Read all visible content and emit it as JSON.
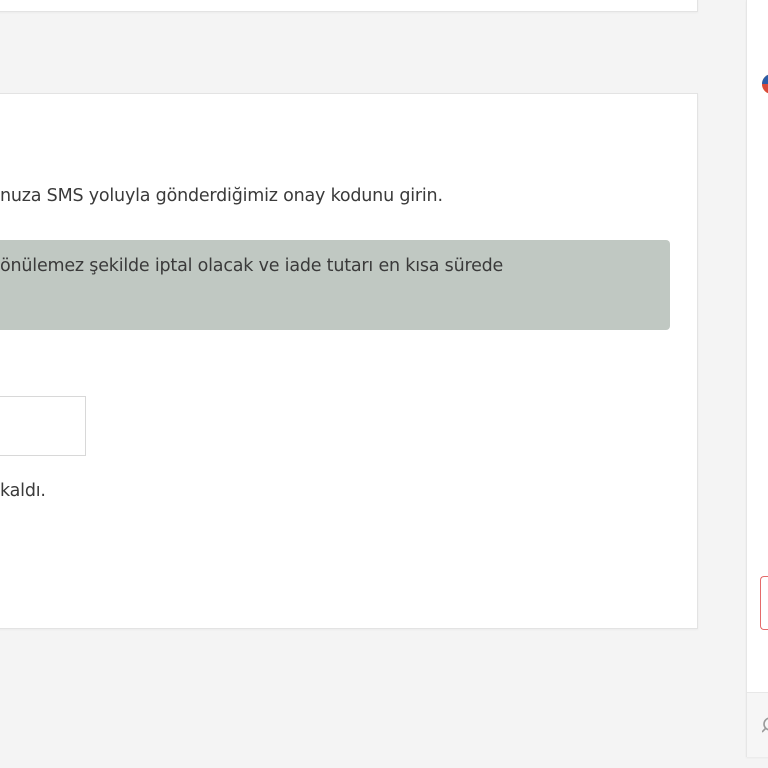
{
  "main": {
    "instruction": "nuza SMS yoluyla gönderdiğimiz onay kodunu girin.",
    "warning": "önülemez şekilde iptal olacak ve iade tutarı en kısa sürede",
    "code_input_value": "",
    "countdown": "kaldı."
  },
  "right_panel": {
    "logo_icon": "brand-logo-icon",
    "button_icon": "red-outline-button",
    "bottom_icon": "search-icon"
  },
  "colors": {
    "page_bg": "#f4f4f4",
    "card_bg": "#ffffff",
    "warning_bg": "#c0c8c2",
    "text": "#3a3a3a",
    "accent_red": "#e56a6a"
  }
}
